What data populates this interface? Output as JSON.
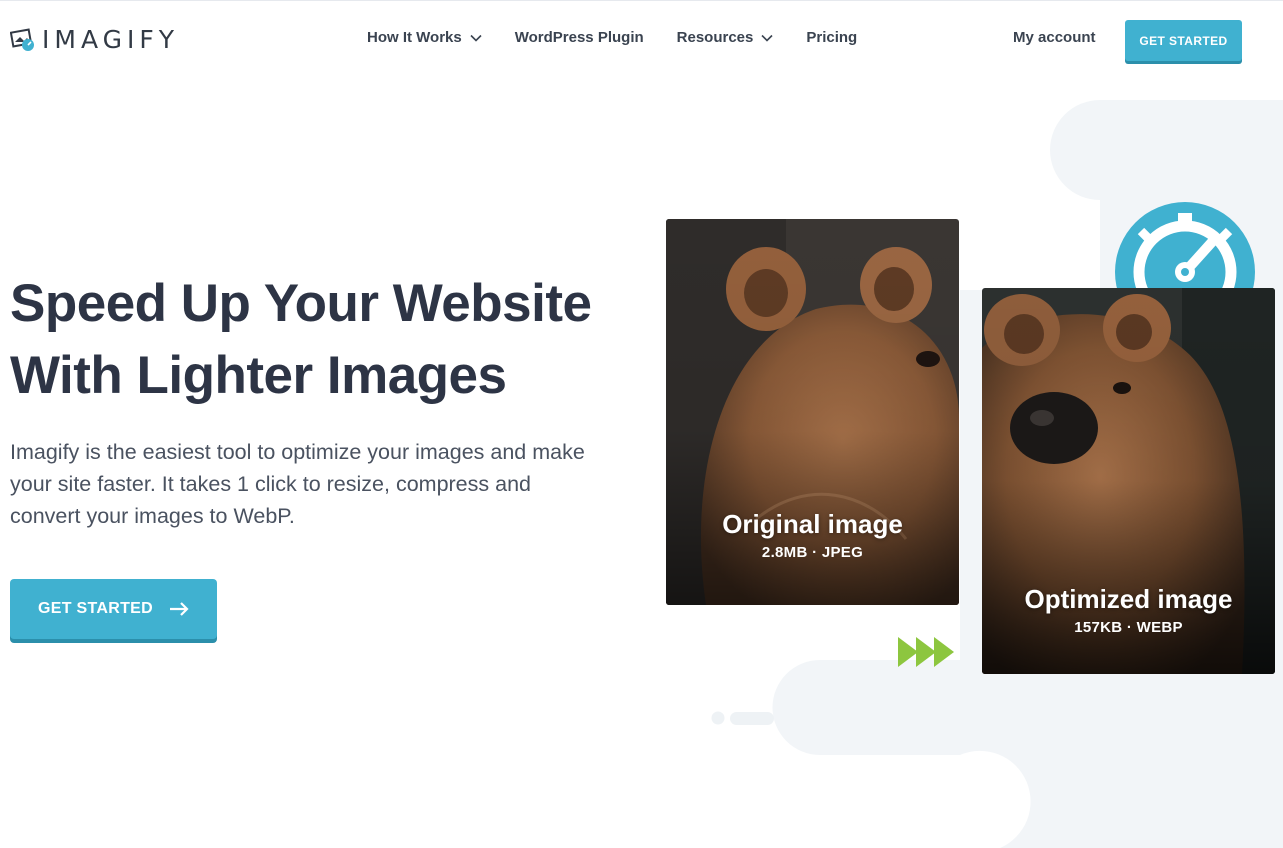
{
  "brand": {
    "name": "IMAGIFY",
    "accent": "#40b1d0",
    "accent_dark": "#2b8fab",
    "arrow_green": "#8dc63f"
  },
  "nav": {
    "items": [
      {
        "label": "How It Works",
        "has_dropdown": true
      },
      {
        "label": "WordPress Plugin",
        "has_dropdown": false
      },
      {
        "label": "Resources",
        "has_dropdown": true
      },
      {
        "label": "Pricing",
        "has_dropdown": false
      }
    ],
    "my_account": "My account",
    "cta": "GET STARTED"
  },
  "hero": {
    "title_line1": "Speed Up Your Website",
    "title_line2": "With Lighter Images",
    "description": "Imagify is the easiest tool to optimize your images and make your site faster. It takes 1 click to resize, compress and convert your images to WebP.",
    "cta": "GET STARTED"
  },
  "comparison": {
    "original": {
      "title": "Original image",
      "meta": "2.8MB · JPEG"
    },
    "optimized": {
      "title": "Optimized image",
      "meta": "157KB · WEBP"
    }
  },
  "icons": [
    "imagify-logo-icon",
    "chevron-down-icon",
    "arrow-right-icon",
    "speedometer-icon",
    "triple-arrow-icon"
  ]
}
